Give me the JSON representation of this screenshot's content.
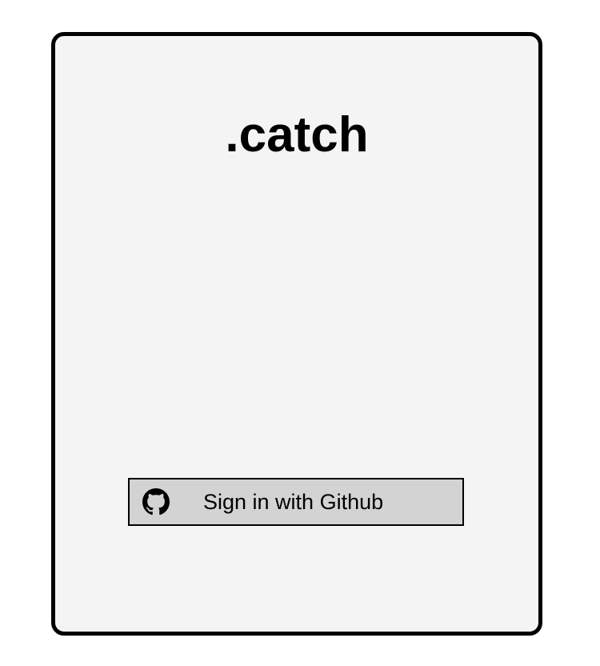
{
  "app": {
    "title": ".catch"
  },
  "login": {
    "button_label": "Sign in with Github",
    "button_icon": "github-icon"
  },
  "colors": {
    "card_background": "#f4f4f4",
    "card_border": "#000000",
    "button_background": "#d3d3d3",
    "text": "#000000"
  }
}
